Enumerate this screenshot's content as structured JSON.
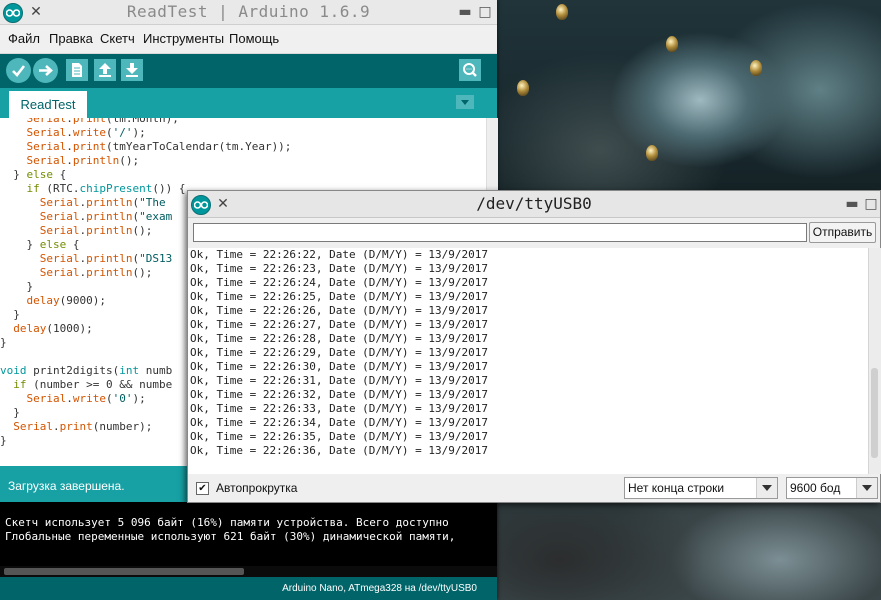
{
  "ide": {
    "title": "ReadTest | Arduino 1.6.9",
    "menu": [
      "Файл",
      "Правка",
      "Скетч",
      "Инструменты",
      "Помощь"
    ],
    "tab_label": "ReadTest",
    "code_lines": [
      "    Serial.print(tm.Month);",
      "    Serial.write('/');",
      "    Serial.print(tmYearToCalendar(tm.Year));",
      "    Serial.println();",
      "  } else {",
      "    if (RTC.chipPresent()) {",
      "      Serial.println(\"The",
      "      Serial.println(\"exam",
      "      Serial.println();",
      "    } else {",
      "      Serial.println(\"DS13",
      "      Serial.println();",
      "    }",
      "    delay(9000);",
      "  }",
      "  delay(1000);",
      "}",
      "",
      "void print2digits(int numb",
      "  if (number >= 0 && numbe",
      "    Serial.write('0');",
      "  }",
      "  Serial.print(number);",
      "}"
    ],
    "status": "Загрузка завершена.",
    "console_lines": [
      "Скетч использует 5 096 байт (16%) памяти устройства. Всего доступно",
      "Глобальные переменные используют 621 байт (30%) динамической памяти,"
    ],
    "footer": "Arduino Nano, ATmega328 на /dev/ttyUSB0"
  },
  "serial": {
    "title": "/dev/ttyUSB0",
    "input_value": "",
    "send_label": "Отправить",
    "output_lines": [
      "Ok, Time = 22:26:22, Date (D/M/Y) = 13/9/2017",
      "Ok, Time = 22:26:23, Date (D/M/Y) = 13/9/2017",
      "Ok, Time = 22:26:24, Date (D/M/Y) = 13/9/2017",
      "Ok, Time = 22:26:25, Date (D/M/Y) = 13/9/2017",
      "Ok, Time = 22:26:26, Date (D/M/Y) = 13/9/2017",
      "Ok, Time = 22:26:27, Date (D/M/Y) = 13/9/2017",
      "Ok, Time = 22:26:28, Date (D/M/Y) = 13/9/2017",
      "Ok, Time = 22:26:29, Date (D/M/Y) = 13/9/2017",
      "Ok, Time = 22:26:30, Date (D/M/Y) = 13/9/2017",
      "Ok, Time = 22:26:31, Date (D/M/Y) = 13/9/2017",
      "Ok, Time = 22:26:32, Date (D/M/Y) = 13/9/2017",
      "Ok, Time = 22:26:33, Date (D/M/Y) = 13/9/2017",
      "Ok, Time = 22:26:34, Date (D/M/Y) = 13/9/2017",
      "Ok, Time = 22:26:35, Date (D/M/Y) = 13/9/2017",
      "Ok, Time = 22:26:36, Date (D/M/Y) = 13/9/2017"
    ],
    "autoscroll_label": "Автопрокрутка",
    "autoscroll_checked": true,
    "line_ending": "Нет конца строки",
    "baud": "9600 бод"
  },
  "colors": {
    "arduino_teal_dark": "#006468",
    "arduino_teal": "#17a1a5",
    "arduino_button": "#4db7bb"
  },
  "icons": [
    "verify-icon",
    "upload-icon",
    "new-icon",
    "open-icon",
    "save-icon",
    "serial-monitor-icon",
    "tab-menu-icon",
    "arduino-logo-icon",
    "close-icon",
    "minimize-icon",
    "maximize-icon",
    "dropdown-arrow-icon"
  ]
}
